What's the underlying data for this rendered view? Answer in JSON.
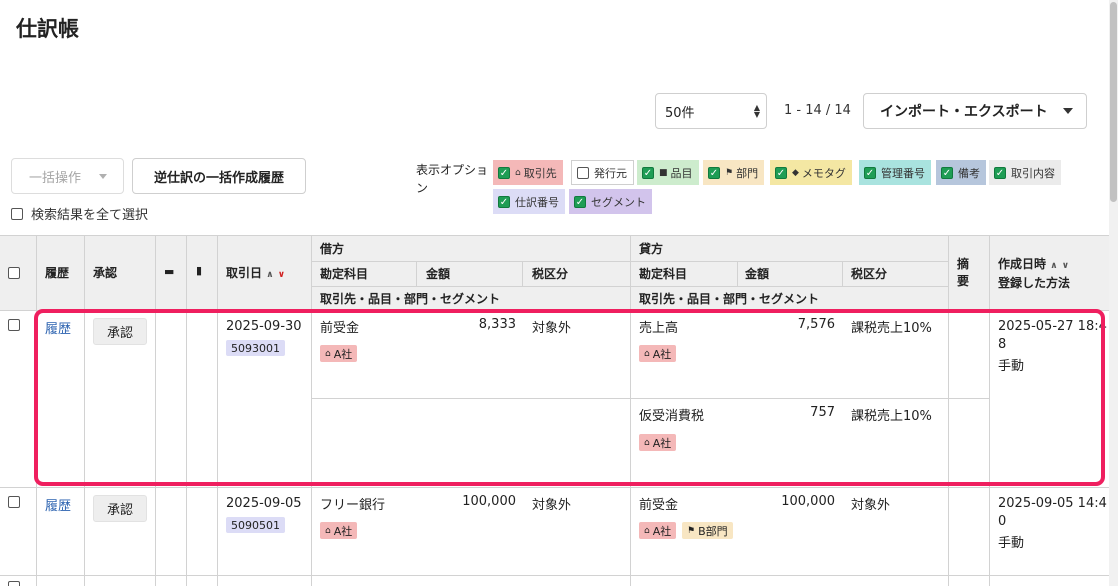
{
  "page": {
    "title": "仕訳帳"
  },
  "toolbar": {
    "page_size": "50件",
    "pagination": "1 - 14 / 14",
    "import_export": "インポート・エクスポート",
    "bulk_action": "一括操作",
    "reverse_history": "逆仕訳の一括作成履歴",
    "select_all": "検索結果を全て選択"
  },
  "display_options": {
    "label": "表示オプション",
    "options": [
      {
        "label": "取引先",
        "checked": true,
        "color": "#f4b8b8",
        "icon": "house-icon"
      },
      {
        "label": "発行元",
        "checked": false,
        "color": "#ffffff"
      },
      {
        "label": "品目",
        "checked": true,
        "color": "#cdeccd",
        "icon": "briefcase-icon"
      },
      {
        "label": "部門",
        "checked": true,
        "color": "#f8e6c3",
        "icon": "flag-icon"
      },
      {
        "label": "メモタグ",
        "checked": true,
        "color": "#f4e7a3",
        "icon": "tag-icon"
      },
      {
        "label": "管理番号",
        "checked": true,
        "color": "#a9e3df"
      },
      {
        "label": "備考",
        "checked": true,
        "color": "#b6c6dc"
      },
      {
        "label": "取引内容",
        "checked": true,
        "color": "#ebebeb"
      },
      {
        "label": "仕訳番号",
        "checked": true,
        "color": "#dcdcf6"
      },
      {
        "label": "セグメント",
        "checked": true,
        "color": "#d2c4ec"
      }
    ]
  },
  "table": {
    "headers": {
      "history": "履歴",
      "approval": "承認",
      "date": "取引日",
      "debit": "借方",
      "credit": "貸方",
      "account": "勘定科目",
      "amount": "金額",
      "tax": "税区分",
      "sub": "取引先・品目・部門・セグメント",
      "summary": "摘要",
      "created": "作成日時",
      "method": "登録した方法"
    },
    "rows": [
      {
        "history": "履歴",
        "approve": "承認",
        "date": "2025-09-30",
        "journal_no": "5093001",
        "debit": {
          "account": "前受金",
          "amount": "8,333",
          "tax": "対象外",
          "tag": "A社"
        },
        "credit": [
          {
            "account": "売上高",
            "amount": "7,576",
            "tax": "課税売上10%",
            "tag": "A社"
          },
          {
            "account": "仮受消費税",
            "amount": "757",
            "tax": "課税売上10%",
            "tag": "A社"
          }
        ],
        "created_1": "2025-05-27 18:4",
        "created_2": "8",
        "method": "手動"
      },
      {
        "history": "履歴",
        "approve": "承認",
        "date": "2025-09-05",
        "journal_no": "5090501",
        "debit": {
          "account": "フリー銀行",
          "amount": "100,000",
          "tax": "対象外",
          "tag": "A社"
        },
        "credit": [
          {
            "account": "前受金",
            "amount": "100,000",
            "tax": "対象外",
            "tag": "A社",
            "dept": "B部門"
          }
        ],
        "created_1": "2025-09-05 14:4",
        "created_2": "0",
        "method": "手動"
      }
    ]
  }
}
